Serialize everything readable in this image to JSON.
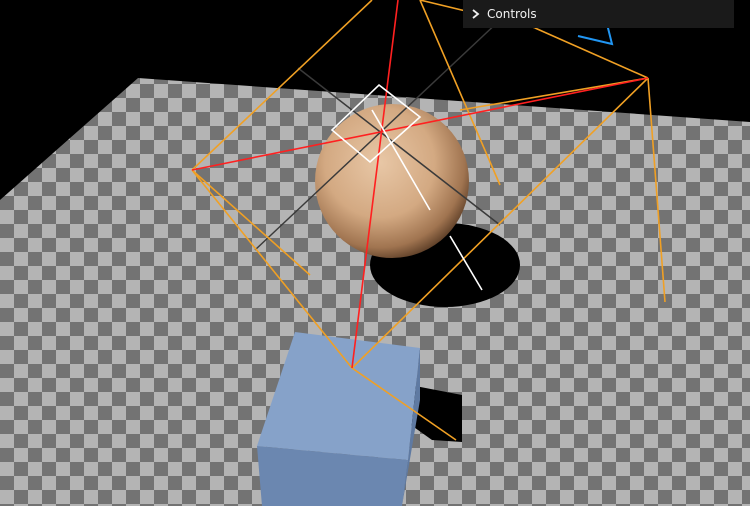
{
  "controls_panel": {
    "title": "Controls",
    "state": "collapsed",
    "icon": "chevron-right-icon"
  },
  "scene": {
    "background_color": "#000000",
    "floor": {
      "pattern": "checkerboard",
      "light_color": "#b4b4b4",
      "dark_color": "#727272"
    },
    "sphere": {
      "color": "#d7ae88"
    },
    "cube": {
      "color": "#7f9bc4"
    },
    "helpers": {
      "frustum_color": "#ffa500",
      "red_lines_color": "#ff2020",
      "white_lines_color": "#ffffff",
      "dark_lines_color": "#333333",
      "blue_helper_color": "#2196f3"
    }
  }
}
